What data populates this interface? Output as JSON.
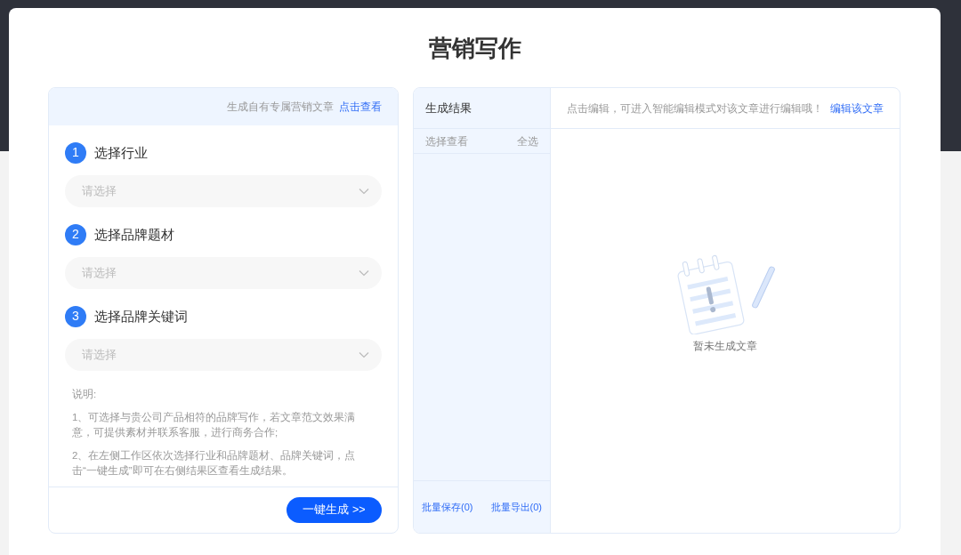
{
  "title": "营销写作",
  "left_panel": {
    "header_text": "生成自有专属营销文章",
    "header_link": "点击查看",
    "steps": [
      {
        "number": "1",
        "label": "选择行业",
        "placeholder": "请选择"
      },
      {
        "number": "2",
        "label": "选择品牌题材",
        "placeholder": "请选择"
      },
      {
        "number": "3",
        "label": "选择品牌关键词",
        "placeholder": "请选择"
      }
    ],
    "notes": {
      "heading": "说明:",
      "items": [
        "1、可选择与贵公司产品相符的品牌写作，若文章范文效果满意，可提供素材并联系客服，进行商务合作;",
        "2、在左侧工作区依次选择行业和品牌题材、品牌关键词，点击“一键生成”即可在右侧结果区查看生成结果。"
      ]
    },
    "generate_button": "一键生成 >>"
  },
  "results": {
    "title": "生成结果",
    "select_label": "选择查看",
    "select_all": "全选",
    "actions": [
      "批量保存(0)",
      "批量导出(0)"
    ]
  },
  "editor": {
    "hint": "点击编辑，可进入智能编辑模式对该文章进行编辑哦！",
    "edit_link": "编辑该文章",
    "empty_text": "暂未生成文章"
  }
}
